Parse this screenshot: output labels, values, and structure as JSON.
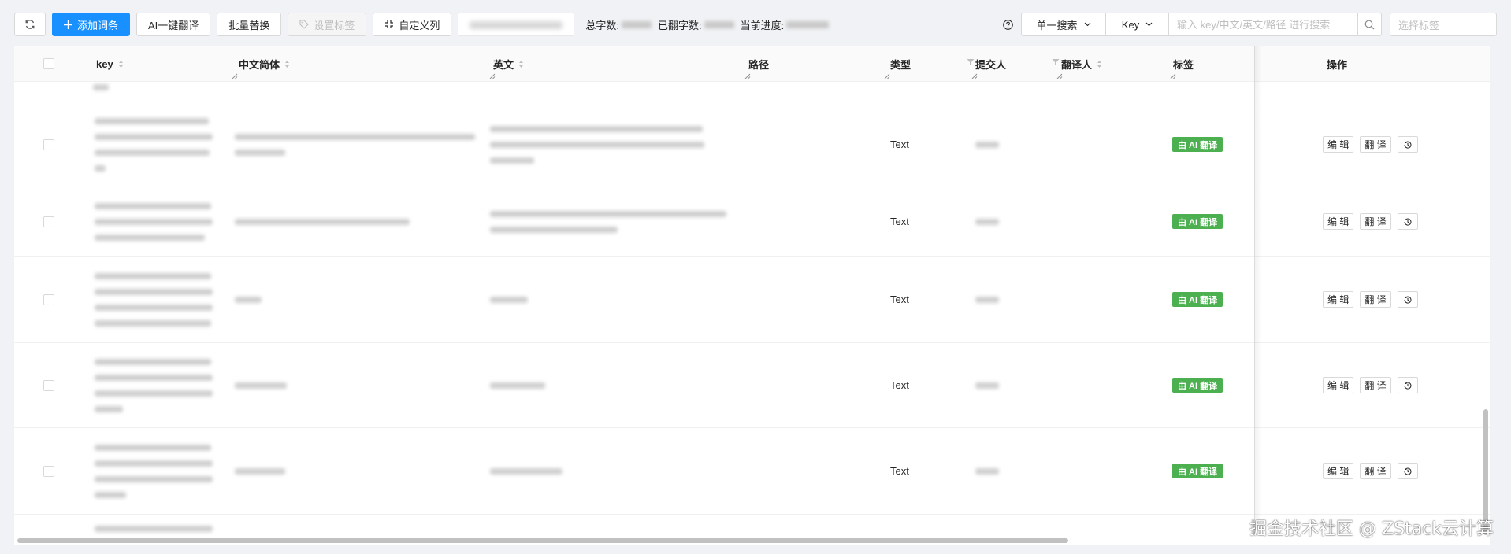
{
  "toolbar": {
    "refresh_icon": "refresh-icon",
    "add_label": "添加词条",
    "ai_translate_label": "AI一键翻译",
    "batch_replace_label": "批量替换",
    "set_tag_label": "设置标签",
    "custom_columns_label": "自定义列",
    "stats": {
      "total_label": "总字数:",
      "translated_label": "已翻字数:",
      "progress_label": "当前进度:"
    },
    "search_mode": "单一搜索",
    "search_field": "Key",
    "search_placeholder": "输入 key/中文/英文/路径 进行搜索",
    "tag_placeholder": "选择标签"
  },
  "table": {
    "columns": {
      "key": "key",
      "zh": "中文简体",
      "en": "英文",
      "path": "路径",
      "type": "类型",
      "submitter": "提交人",
      "translator": "翻译人",
      "tags": "标签",
      "actions": "操作"
    },
    "rows": [
      {
        "type": "Text",
        "tag": "由 AI 翻译",
        "edit": "编 辑",
        "translate": "翻 译"
      },
      {
        "type": "Text",
        "tag": "由 AI 翻译",
        "edit": "编 辑",
        "translate": "翻 译"
      },
      {
        "type": "Text",
        "tag": "由 AI 翻译",
        "edit": "编 辑",
        "translate": "翻 译"
      },
      {
        "type": "Text",
        "tag": "由 AI 翻译",
        "edit": "编 辑",
        "translate": "翻 译"
      },
      {
        "type": "Text",
        "tag": "由 AI 翻译",
        "edit": "编 辑",
        "translate": "翻 译"
      }
    ]
  },
  "colors": {
    "primary": "#1890ff",
    "ai_badge": "#4caf50"
  },
  "watermark": "掘金技术社区 @ ZStack云计算"
}
